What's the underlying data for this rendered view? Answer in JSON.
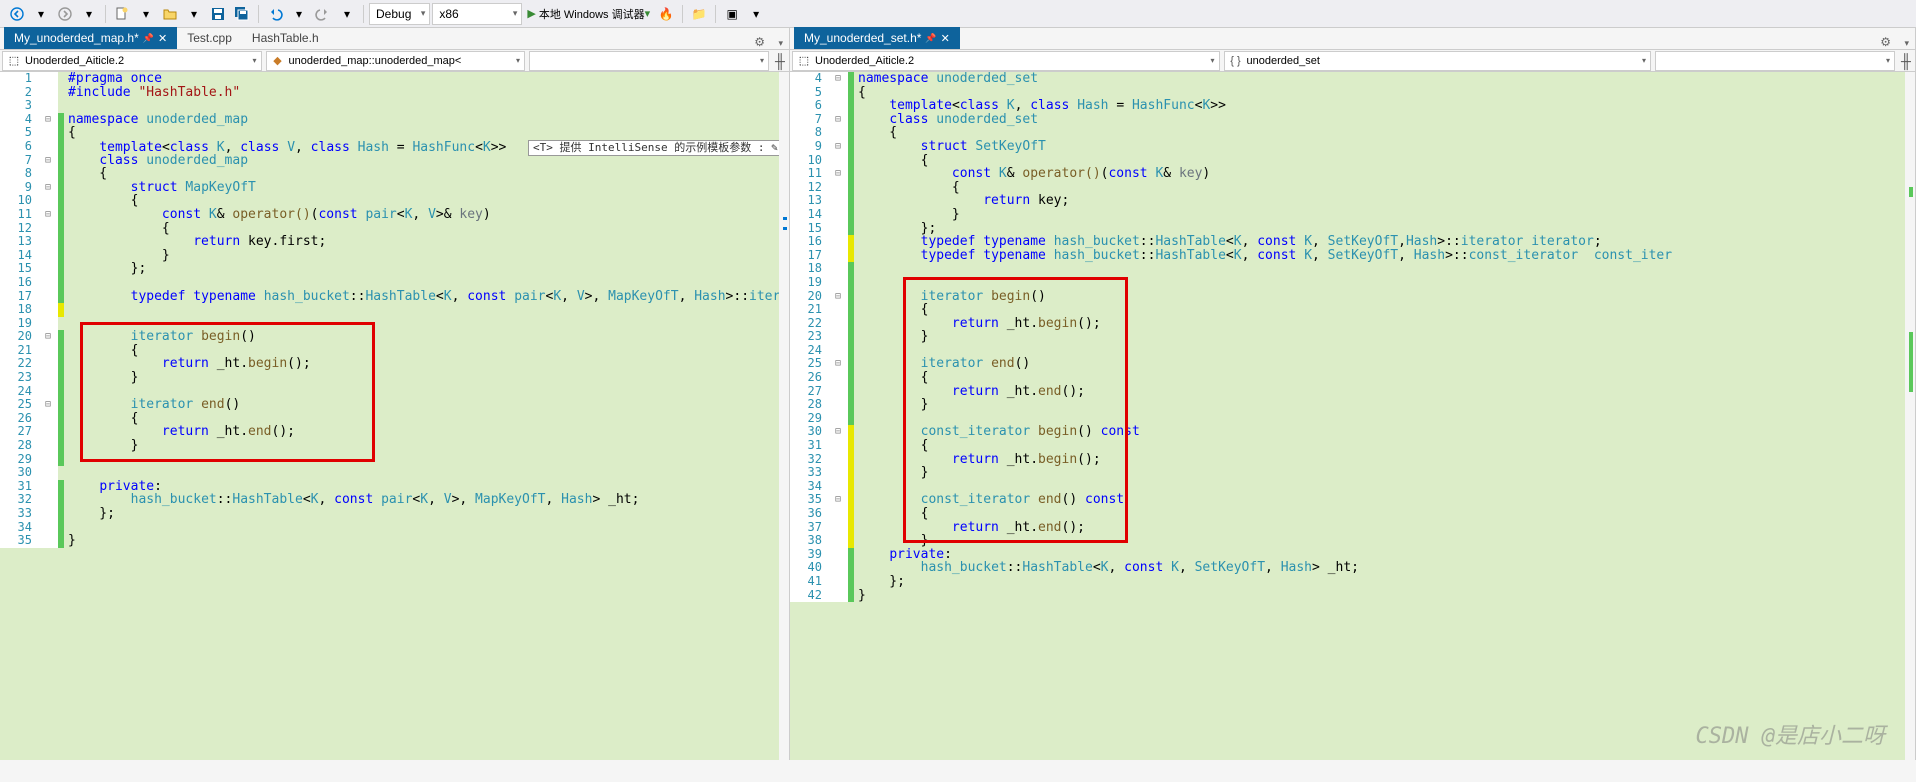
{
  "toolbar": {
    "config_dd": "Debug",
    "platform_dd": "x86",
    "run_label": "本地 Windows 调试器"
  },
  "left": {
    "tabs": [
      {
        "label": "My_unoderded_map.h*",
        "active": true
      },
      {
        "label": "Test.cpp",
        "active": false
      },
      {
        "label": "HashTable.h",
        "active": false
      }
    ],
    "crumb1": "Unoderded_Aiticle.2",
    "crumb2": "unoderded_map::unoderded_map<",
    "lines": [
      {
        "n": 1,
        "f": "",
        "i": "",
        "html": "<span class='kw'>#pragma</span> <span class='kw'>once</span>"
      },
      {
        "n": 2,
        "f": "",
        "i": "",
        "html": "<span class='kw'>#include</span> <span class='str'>\"HashTable.h\"</span>"
      },
      {
        "n": 3,
        "f": "",
        "i": "",
        "html": ""
      },
      {
        "n": 4,
        "f": "⊟",
        "i": "g",
        "html": "<span class='kw'>namespace</span> <span class='ns'>unoderded_map</span>"
      },
      {
        "n": 5,
        "f": "",
        "i": "g",
        "html": "{"
      },
      {
        "n": 6,
        "f": "",
        "i": "g",
        "html": "    <span class='kw'>template</span>&lt;<span class='kw'>class</span> <span class='type'>K</span>, <span class='kw'>class</span> <span class='type'>V</span>, <span class='kw'>class</span> <span class='type'>Hash</span> = <span class='type'>HashFunc</span>&lt;<span class='type'>K</span>&gt;&gt;  <span class='hint-box'>&lt;T&gt; 提供 IntelliSense 的示例模板参数 : ✎</span>"
      },
      {
        "n": 7,
        "f": "⊟",
        "i": "g",
        "html": "    <span class='kw'>class</span> <span class='cls'>unoderded_map</span>"
      },
      {
        "n": 8,
        "f": "",
        "i": "g",
        "html": "    {"
      },
      {
        "n": 9,
        "f": "⊟",
        "i": "g",
        "html": "        <span class='kw'>struct</span> <span class='cls'>MapKeyOfT</span>"
      },
      {
        "n": 10,
        "f": "",
        "i": "g",
        "html": "        {"
      },
      {
        "n": 11,
        "f": "⊟",
        "i": "g",
        "html": "            <span class='kw'>const</span> <span class='type'>K</span>&amp; <span class='func'>operator()</span>(<span class='kw'>const</span> <span class='type'>pair</span>&lt;<span class='type'>K</span>, <span class='type'>V</span>&gt;&amp; <span class='cmt'>key</span>)"
      },
      {
        "n": 12,
        "f": "",
        "i": "g",
        "html": "            {"
      },
      {
        "n": 13,
        "f": "",
        "i": "g",
        "html": "                <span class='kw'>return</span> key.first;"
      },
      {
        "n": 14,
        "f": "",
        "i": "g",
        "html": "            }"
      },
      {
        "n": 15,
        "f": "",
        "i": "g",
        "html": "        };"
      },
      {
        "n": 16,
        "f": "",
        "i": "g",
        "html": ""
      },
      {
        "n": 17,
        "f": "",
        "i": "g",
        "html": "        <span class='kw'>typedef</span> <span class='kw'>typename</span> <span class='ns'>hash_bucket</span>::<span class='cls'>HashTable</span>&lt;<span class='type'>K</span>, <span class='kw'>const</span> <span class='type'>pair</span>&lt;<span class='type'>K</span>, <span class='type'>V</span>&gt;, <span class='type'>MapKeyOfT</span>, <span class='type'>Hash</span>&gt;::<span class='type'>iterator</span> <span class='type'>iterator</span>;"
      },
      {
        "n": 18,
        "f": "",
        "i": "y",
        "html": ""
      },
      {
        "n": 19,
        "f": "",
        "i": "",
        "html": ""
      },
      {
        "n": 20,
        "f": "⊟",
        "i": "g",
        "html": "        <span class='type'>iterator</span> <span class='func'>begin</span>()"
      },
      {
        "n": 21,
        "f": "",
        "i": "g",
        "html": "        {"
      },
      {
        "n": 22,
        "f": "",
        "i": "g",
        "html": "            <span class='kw'>return</span> _ht.<span class='func'>begin</span>();"
      },
      {
        "n": 23,
        "f": "",
        "i": "g",
        "html": "        }"
      },
      {
        "n": 24,
        "f": "",
        "i": "g",
        "html": ""
      },
      {
        "n": 25,
        "f": "⊟",
        "i": "g",
        "html": "        <span class='type'>iterator</span> <span class='func'>end</span>()"
      },
      {
        "n": 26,
        "f": "",
        "i": "g",
        "html": "        {"
      },
      {
        "n": 27,
        "f": "",
        "i": "g",
        "html": "            <span class='kw'>return</span> _ht.<span class='func'>end</span>();"
      },
      {
        "n": 28,
        "f": "",
        "i": "g",
        "html": "        }"
      },
      {
        "n": 29,
        "f": "",
        "i": "g",
        "html": ""
      },
      {
        "n": 30,
        "f": "",
        "i": "",
        "html": ""
      },
      {
        "n": 31,
        "f": "",
        "i": "g",
        "html": "    <span class='kw'>private</span>:"
      },
      {
        "n": 32,
        "f": "",
        "i": "g",
        "html": "        <span class='ns'>hash_bucket</span>::<span class='cls'>HashTable</span>&lt;<span class='type'>K</span>, <span class='kw'>const</span> <span class='type'>pair</span>&lt;<span class='type'>K</span>, <span class='type'>V</span>&gt;, <span class='type'>MapKeyOfT</span>, <span class='type'>Hash</span>&gt; _ht;"
      },
      {
        "n": 33,
        "f": "",
        "i": "g",
        "html": "    };"
      },
      {
        "n": 34,
        "f": "",
        "i": "g",
        "html": ""
      },
      {
        "n": 35,
        "f": "",
        "i": "g",
        "html": "}"
      }
    ]
  },
  "right": {
    "tabs": [
      {
        "label": "My_unoderded_set.h*",
        "active": true
      }
    ],
    "crumb1": "Unoderded_Aiticle.2",
    "crumb2": "unoderded_set",
    "lines": [
      {
        "n": 4,
        "f": "⊟",
        "i": "g",
        "html": "<span class='kw'>namespace</span> <span class='ns'>unoderded_set</span>"
      },
      {
        "n": 5,
        "f": "",
        "i": "g",
        "html": "{"
      },
      {
        "n": 6,
        "f": "",
        "i": "g",
        "html": "    <span class='kw'>template</span>&lt;<span class='kw'>class</span> <span class='type'>K</span>, <span class='kw'>class</span> <span class='type'>Hash</span> = <span class='type'>HashFunc</span>&lt;<span class='type'>K</span>&gt;&gt;"
      },
      {
        "n": 7,
        "f": "⊟",
        "i": "g",
        "html": "    <span class='kw'>class</span> <span class='cls'>unoderded_set</span>"
      },
      {
        "n": 8,
        "f": "",
        "i": "g",
        "html": "    {"
      },
      {
        "n": 9,
        "f": "⊟",
        "i": "g",
        "html": "        <span class='kw'>struct</span> <span class='cls'>SetKeyOfT</span>"
      },
      {
        "n": 10,
        "f": "",
        "i": "g",
        "html": "        {"
      },
      {
        "n": 11,
        "f": "⊟",
        "i": "g",
        "html": "            <span class='kw'>const</span> <span class='type'>K</span>&amp; <span class='func'>operator()</span>(<span class='kw'>const</span> <span class='type'>K</span>&amp; <span class='cmt'>key</span>)"
      },
      {
        "n": 12,
        "f": "",
        "i": "g",
        "html": "            {"
      },
      {
        "n": 13,
        "f": "",
        "i": "g",
        "html": "                <span class='kw'>return</span> key;"
      },
      {
        "n": 14,
        "f": "",
        "i": "g",
        "html": "            }"
      },
      {
        "n": 15,
        "f": "",
        "i": "g",
        "html": "        };"
      },
      {
        "n": 16,
        "f": "",
        "i": "y",
        "html": "        <span class='kw'>typedef</span> <span class='kw'>typename</span> <span class='ns'>hash_bucket</span>::<span class='cls'>HashTable</span>&lt;<span class='type'>K</span>, <span class='kw'>const</span> <span class='type'>K</span>, <span class='type'>SetKeyOfT</span>,<span class='type'>Hash</span>&gt;::<span class='type'>iterator</span> <span class='type'>iterator</span>;"
      },
      {
        "n": 17,
        "f": "",
        "i": "y",
        "html": "        <span class='kw'>typedef</span> <span class='kw'>typename</span> <span class='ns'>hash_bucket</span>::<span class='cls'>HashTable</span>&lt;<span class='type'>K</span>, <span class='kw'>const</span> <span class='type'>K</span>, <span class='type'>SetKeyOfT</span>, <span class='type'>Hash</span>&gt;::<span class='type'>const_iterator</span>  <span class='type'>const_iter</span>"
      },
      {
        "n": 18,
        "f": "",
        "i": "g",
        "html": ""
      },
      {
        "n": 19,
        "f": "",
        "i": "g",
        "html": ""
      },
      {
        "n": 20,
        "f": "⊟",
        "i": "g",
        "html": "        <span class='type'>iterator</span> <span class='func'>begin</span>()"
      },
      {
        "n": 21,
        "f": "",
        "i": "g",
        "html": "        {"
      },
      {
        "n": 22,
        "f": "",
        "i": "g",
        "html": "            <span class='kw'>return</span> _ht.<span class='func'>begin</span>();"
      },
      {
        "n": 23,
        "f": "",
        "i": "g",
        "html": "        }"
      },
      {
        "n": 24,
        "f": "",
        "i": "g",
        "html": ""
      },
      {
        "n": 25,
        "f": "⊟",
        "i": "g",
        "html": "        <span class='type'>iterator</span> <span class='func'>end</span>()"
      },
      {
        "n": 26,
        "f": "",
        "i": "g",
        "html": "        {"
      },
      {
        "n": 27,
        "f": "",
        "i": "g",
        "html": "            <span class='kw'>return</span> _ht.<span class='func'>end</span>();"
      },
      {
        "n": 28,
        "f": "",
        "i": "g",
        "html": "        }"
      },
      {
        "n": 29,
        "f": "",
        "i": "g",
        "html": ""
      },
      {
        "n": 30,
        "f": "⊟",
        "i": "y",
        "html": "        <span class='type'>const_iterator</span> <span class='func'>begin</span>() <span class='kw'>const</span>"
      },
      {
        "n": 31,
        "f": "",
        "i": "y",
        "html": "        {"
      },
      {
        "n": 32,
        "f": "",
        "i": "y",
        "html": "            <span class='kw'>return</span> _ht.<span class='func'>begin</span>();"
      },
      {
        "n": 33,
        "f": "",
        "i": "y",
        "html": "        }"
      },
      {
        "n": 34,
        "f": "",
        "i": "y",
        "html": ""
      },
      {
        "n": 35,
        "f": "⊟",
        "i": "y",
        "html": "        <span class='type'>const_iterator</span> <span class='func'>end</span>() <span class='kw'>const</span>"
      },
      {
        "n": 36,
        "f": "",
        "i": "y",
        "html": "        {"
      },
      {
        "n": 37,
        "f": "",
        "i": "y",
        "html": "            <span class='kw'>return</span> _ht.<span class='func'>end</span>();"
      },
      {
        "n": 38,
        "f": "",
        "i": "y",
        "html": "        }"
      },
      {
        "n": 39,
        "f": "",
        "i": "g",
        "html": "    <span class='kw'>private</span>:"
      },
      {
        "n": 40,
        "f": "",
        "i": "g",
        "html": "        <span class='ns'>hash_bucket</span>::<span class='cls'>HashTable</span>&lt;<span class='type'>K</span>, <span class='kw'>const</span> <span class='type'>K</span>, <span class='type'>SetKeyOfT</span>, <span class='type'>Hash</span>&gt; _ht;"
      },
      {
        "n": 41,
        "f": "",
        "i": "g",
        "html": "    };"
      },
      {
        "n": 42,
        "f": "",
        "i": "g",
        "html": "}"
      }
    ]
  },
  "watermark": "CSDN @是店小二呀"
}
